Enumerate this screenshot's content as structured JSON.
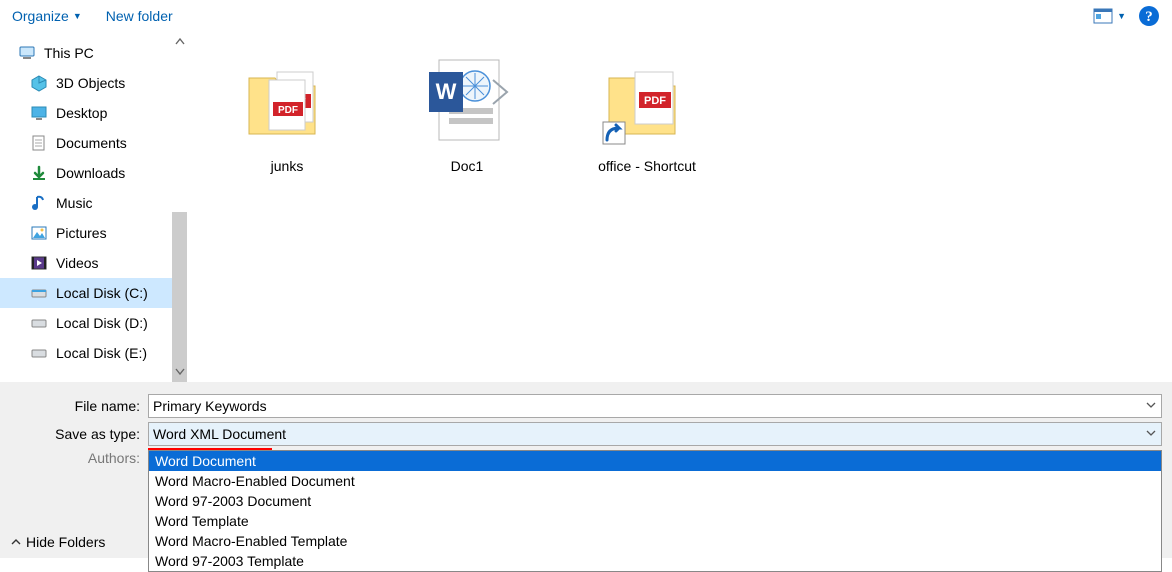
{
  "toolbar": {
    "organize_label": "Organize",
    "new_folder_label": "New folder"
  },
  "sidebar": {
    "root": "This PC",
    "items": [
      {
        "label": "3D Objects"
      },
      {
        "label": "Desktop"
      },
      {
        "label": "Documents"
      },
      {
        "label": "Downloads"
      },
      {
        "label": "Music"
      },
      {
        "label": "Pictures"
      },
      {
        "label": "Videos"
      },
      {
        "label": "Local Disk (C:)",
        "selected": true
      },
      {
        "label": "Local Disk (D:)"
      },
      {
        "label": "Local Disk (E:)"
      }
    ]
  },
  "files": [
    {
      "label": "junks"
    },
    {
      "label": "Doc1"
    },
    {
      "label": "office - Shortcut"
    }
  ],
  "form": {
    "filename_label": "File name:",
    "filetype_label": "Save as type:",
    "authors_label": "Authors:",
    "filename_value": "Primary Keywords",
    "filetype_value": "Word XML Document"
  },
  "dropdown": {
    "options": [
      {
        "label": "Word Document",
        "selected": true
      },
      {
        "label": "Word Macro-Enabled Document"
      },
      {
        "label": "Word 97-2003 Document"
      },
      {
        "label": "Word Template"
      },
      {
        "label": "Word Macro-Enabled Template"
      },
      {
        "label": "Word 97-2003 Template"
      }
    ]
  },
  "hide_folders_label": "Hide Folders"
}
